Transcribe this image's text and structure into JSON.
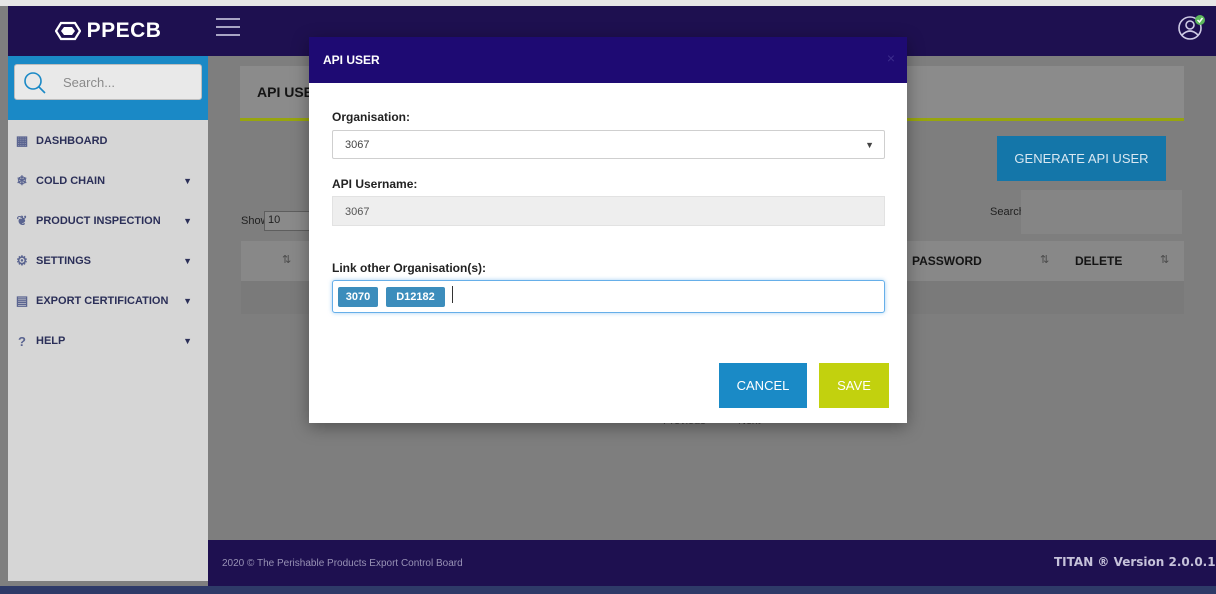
{
  "app": {
    "brand": "PPECB"
  },
  "search": {
    "placeholder": "Search..."
  },
  "sidebar": {
    "items": [
      {
        "label": "DASHBOARD"
      },
      {
        "label": "COLD CHAIN"
      },
      {
        "label": "PRODUCT INSPECTION"
      },
      {
        "label": "SETTINGS"
      },
      {
        "label": "EXPORT CERTIFICATION"
      },
      {
        "label": "HELP"
      }
    ]
  },
  "page": {
    "title": "API USE",
    "generate_button": "GENERATE API USER",
    "show_label": "Show",
    "show_value": "10",
    "search_label": "Search:",
    "columns": {
      "password": "PASSWORD",
      "delete": "DELETE"
    },
    "pager": {
      "previous": "Previous",
      "next": "Next"
    }
  },
  "modal": {
    "title": "API USER",
    "close": "×",
    "organisation_label": "Organisation:",
    "organisation_value": "3067",
    "username_label": "API Username:",
    "username_value": "3067",
    "link_label": "Link other Organisation(s):",
    "tags": [
      "3070",
      "D12182"
    ],
    "cancel": "CANCEL",
    "save": "SAVE"
  },
  "footer": {
    "copyright": "2020 © The Perishable Products Export Control Board",
    "version": "TITAN ® Version 2.0.0.1"
  }
}
